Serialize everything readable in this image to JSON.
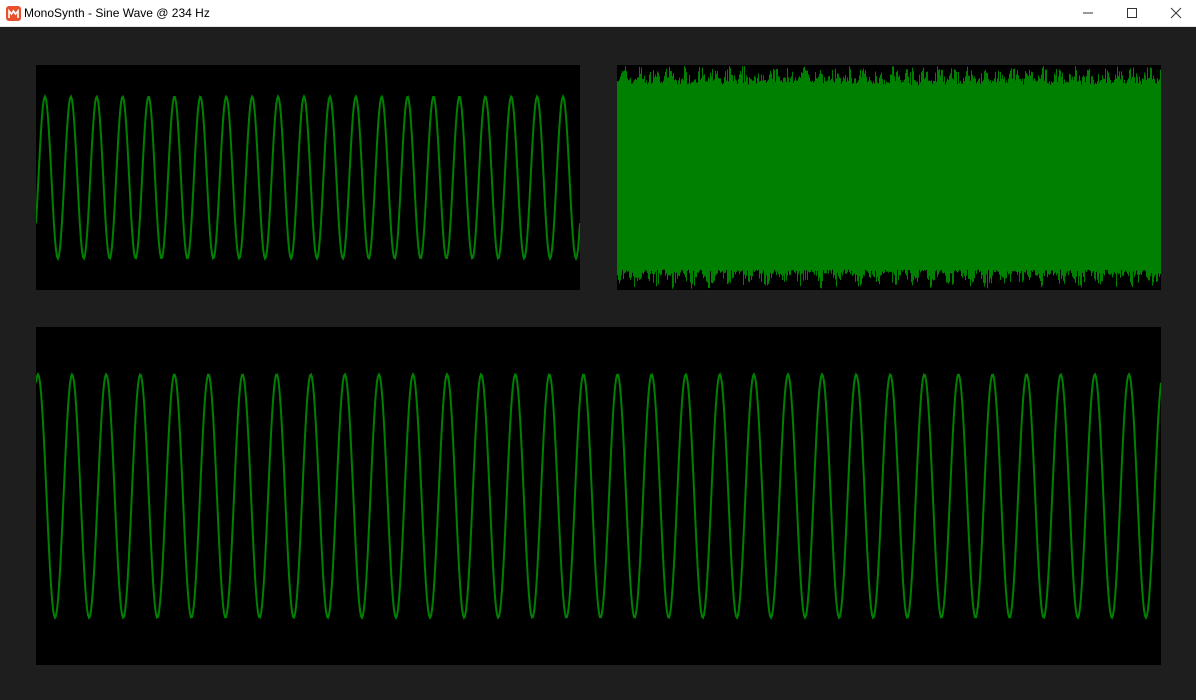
{
  "window": {
    "title": "MonoSynth - Sine Wave @ 234 Hz",
    "app_icon": "monogame-logo-icon",
    "controls": {
      "minimize": "minimize-icon",
      "maximize": "maximize-icon",
      "close": "close-icon"
    }
  },
  "colors": {
    "background": "#1e1e1e",
    "scope_background": "#000000",
    "trace": "#008000",
    "titlebar": "#ffffff",
    "app_icon": "#e7512d"
  },
  "scopes": {
    "waveform_zoomed": {
      "waveform": "sine",
      "cycles_visible": 21,
      "amplitude_fraction": 0.72
    },
    "waveform_dense": {
      "waveform": "sine",
      "fill": "dense"
    },
    "waveform_wide": {
      "waveform": "sine",
      "cycles_visible": 33,
      "amplitude_fraction": 0.72
    }
  }
}
